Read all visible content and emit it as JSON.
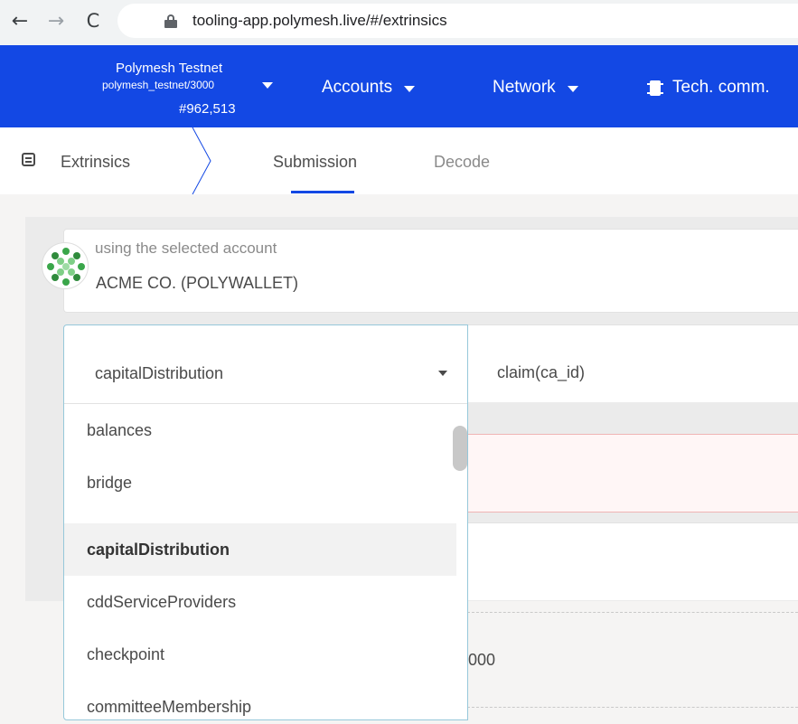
{
  "browser": {
    "back_glyph": "←",
    "forward_glyph": "→",
    "reload_glyph": "C",
    "url": "tooling-app.polymesh.live/#/extrinsics"
  },
  "header": {
    "chain_name": "Polymesh Testnet",
    "chain_spec": "polymesh_testnet/3000",
    "block_number": "#962,513",
    "menu": {
      "accounts": "Accounts",
      "network": "Network",
      "tech": "Tech. comm."
    },
    "brand_color": "#1348e4"
  },
  "tabs": {
    "title": "Extrinsics",
    "submission": "Submission",
    "decode": "Decode"
  },
  "account": {
    "hint": "using the selected account",
    "name": "ACME CO. (POLYWALLET)"
  },
  "module_select": {
    "selected": "capitalDistribution",
    "options": [
      "balances",
      "bridge",
      "capitalDistribution",
      "cddServiceProviders",
      "checkpoint",
      "committeeMembership"
    ],
    "active_index": 2
  },
  "method_select": {
    "selected": "claim(ca_id)"
  },
  "partial_value": "000"
}
